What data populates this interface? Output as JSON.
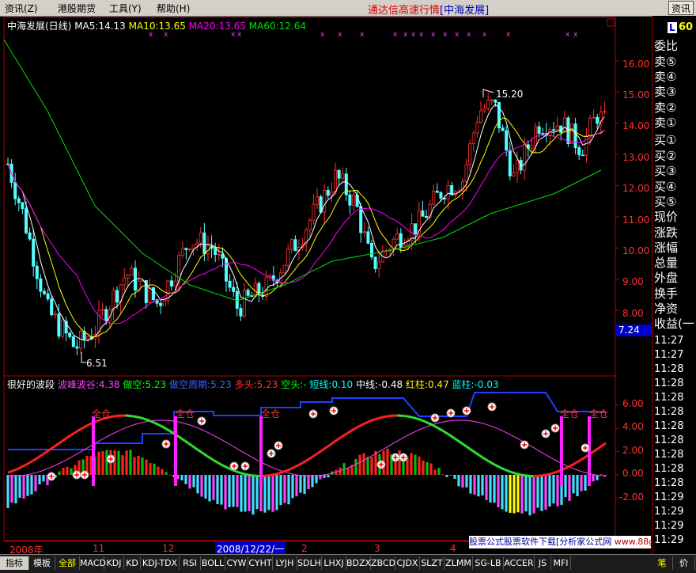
{
  "menu": [
    "资讯(Z)",
    "港股期货",
    "工具(Y)",
    "帮助(H)"
  ],
  "app_title": "通达信高速行情",
  "app_code": "[中海发展]",
  "info_button": "资讯",
  "main_legend": {
    "stock": "中海发展(日线)",
    "ma5": "MA5:14.13",
    "ma10": "MA10:13.65",
    "ma20": "MA20:13.65",
    "ma60": "MA60:12.64"
  },
  "price_annotations": {
    "high": "15.20",
    "low": "6.51"
  },
  "price_axis": [
    "16.00",
    "15.00",
    "14.00",
    "13.00",
    "12.00",
    "11.00",
    "10.00",
    "9.00",
    "8.00"
  ],
  "current_price_box": "7.24",
  "indicator_legend": {
    "title": "很好的波段",
    "item1": "波峰波谷:4.38",
    "item2": "做空:5.23",
    "item3": "做空周期:5.23",
    "item4": "多头:5.23",
    "item5": "空头:-",
    "item6": "短线:0.10",
    "item7": "中线:-0.48",
    "item8": "红柱:0.47",
    "item9": "蓝柱:-0.03"
  },
  "indicator_axis": [
    "6.00",
    "4.00",
    "2.00",
    "0.00",
    "-2.00"
  ],
  "full_pos_label": "全仓",
  "date_axis": {
    "year": "2008年",
    "m11": "11",
    "m12": "12",
    "cursor_date": "2008/12/22/一",
    "m2": "2",
    "m3": "3",
    "m4": "4"
  },
  "side_panel": {
    "l_badge": "L",
    "top_number": "60",
    "items": [
      "委比",
      "卖⑤",
      "卖④",
      "卖③",
      "卖②",
      "卖①",
      "买①",
      "买②",
      "买③",
      "买④",
      "买⑤",
      "现价",
      "涨跌",
      "涨幅",
      "总量",
      "外盘",
      "换手",
      "净资",
      "收益(一"
    ],
    "times": [
      "11:27",
      "11:27",
      "11:28",
      "11:28",
      "11:28",
      "11:28",
      "11:28",
      "11:28",
      "11:28",
      "11:28",
      "11:28",
      "11:29",
      "11:29",
      "11:29",
      "11:29",
      "11:29",
      "11:29"
    ],
    "bottom_tabs": [
      "笔",
      "价"
    ]
  },
  "tabs": [
    "指标",
    "模板",
    "全部",
    "MACD",
    "KDJ",
    "KD",
    "KDJ-TDX",
    "RSI",
    "BOLL",
    "CYW",
    "CYHT",
    "LYJH",
    "SDLH",
    "LHXJ",
    "BDZX",
    "ZBCD",
    "CJDX",
    "SLZT",
    "ZLMM",
    "SG-LB",
    "ACCER",
    "JS",
    "MFI"
  ],
  "watermark": {
    "text": "股票公式股票软件下载[分析家公式网",
    "url": "www.88gs.com"
  },
  "colors": {
    "up": "#ff3030",
    "down": "#54ffff",
    "ma5": "#ffffff",
    "ma10": "#ffff00",
    "ma20": "#ff00ff",
    "ma60": "#00e000",
    "axis": "#b00000",
    "label": "#ff3030"
  }
}
